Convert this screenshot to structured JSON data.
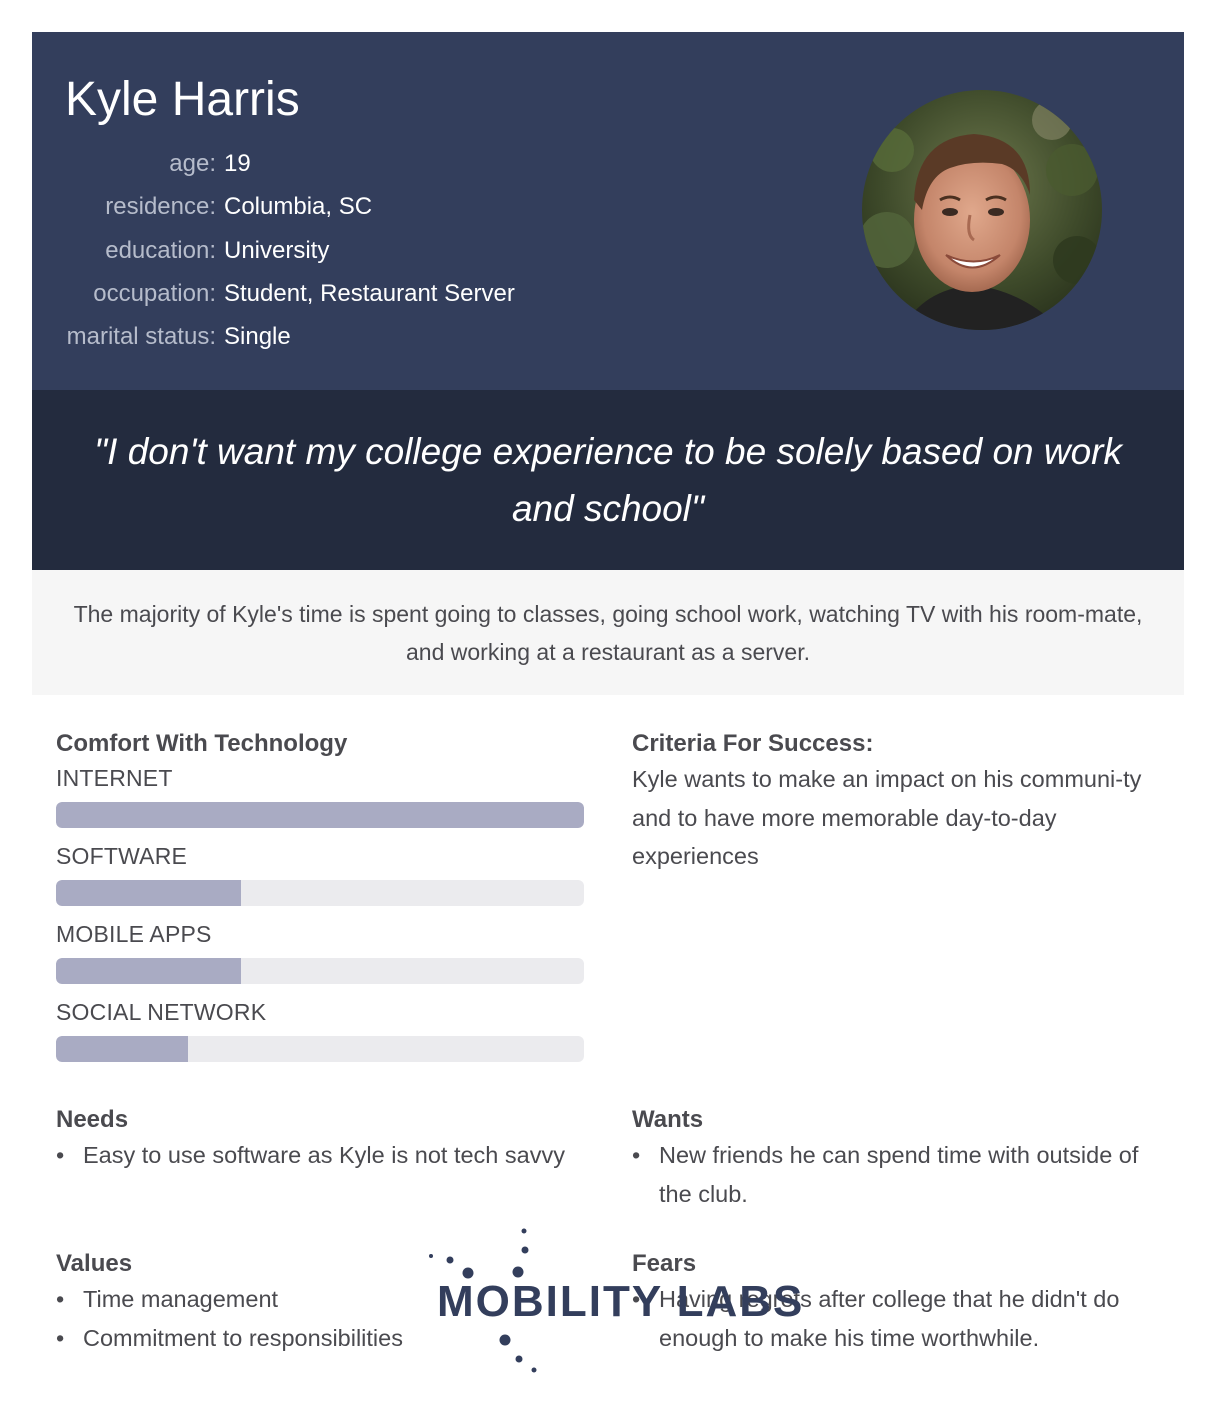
{
  "persona": {
    "name": "Kyle Harris",
    "facts": [
      {
        "label": "age:",
        "value": "19"
      },
      {
        "label": "residence:",
        "value": "Columbia, SC"
      },
      {
        "label": "education:",
        "value": "University"
      },
      {
        "label": "occupation:",
        "value": "Student, Restaurant Server"
      },
      {
        "label": "marital status:",
        "value": "Single"
      }
    ],
    "quote": "\"I don't want my college experience to be solely based on work and school\"",
    "summary": "The majority of Kyle's time is spent going to classes, going school work, watching TV with his room-mate, and working at a restaurant as a server."
  },
  "technology": {
    "title": "Comfort With Technology",
    "meters": [
      {
        "label": "INTERNET",
        "level": 1.0
      },
      {
        "label": "SOFTWARE",
        "level": 0.35
      },
      {
        "label": "MOBILE APPS",
        "level": 0.35
      },
      {
        "label": "SOCIAL NETWORK",
        "level": 0.25
      }
    ]
  },
  "criteria": {
    "title": "Criteria For Success:",
    "text": "Kyle wants to make an impact on his communi-ty and to have more memorable day-to-day experiences"
  },
  "needs": {
    "title": "Needs",
    "items": [
      "Easy to use software as Kyle is not tech savvy"
    ]
  },
  "wants": {
    "title": "Wants",
    "items": [
      "New friends he can spend time with outside of the club."
    ]
  },
  "values": {
    "title": "Values",
    "items": [
      "Time management",
      "Commitment to responsibilities"
    ]
  },
  "fears": {
    "title": "Fears",
    "items": [
      "Having regrets after college that he didn't do enough to make his time worthwhile."
    ]
  },
  "watermark": {
    "text": "MOBILITY LABS"
  },
  "colors": {
    "header": "#333e5c",
    "quote_band": "#232b3e",
    "summary_band": "#f6f6f6",
    "meter_fill": "#a9abc3",
    "meter_track": "#ebebee"
  }
}
